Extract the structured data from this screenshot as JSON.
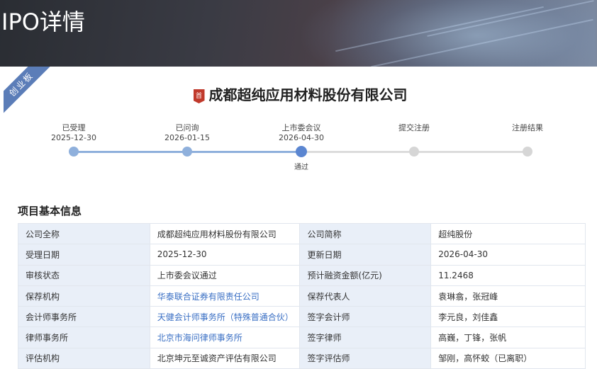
{
  "page": {
    "title": "IPO详情"
  },
  "board_ribbon": "创业板",
  "company": {
    "badge": "首",
    "name": "成都超纯应用材料股份有限公司"
  },
  "progress": {
    "steps": [
      {
        "label": "已受理",
        "date": "2025-12-30",
        "status": "done"
      },
      {
        "label": "已问询",
        "date": "2026-01-15",
        "status": "done"
      },
      {
        "label": "上市委会议",
        "date": "2026-04-30",
        "status": "current",
        "sub": "通过"
      },
      {
        "label": "提交注册",
        "date": "",
        "status": "todo"
      },
      {
        "label": "注册结果",
        "date": "",
        "status": "todo"
      }
    ]
  },
  "section": {
    "title": "项目基本信息"
  },
  "info": {
    "rows": [
      {
        "k1": "公司全称",
        "v1": "成都超纯应用材料股份有限公司",
        "k2": "公司简称",
        "v2": "超纯股份"
      },
      {
        "k1": "受理日期",
        "v1": "2025-12-30",
        "k2": "更新日期",
        "v2": "2026-04-30"
      },
      {
        "k1": "审核状态",
        "v1": "上市委会议通过",
        "k2": "预计融资金额(亿元)",
        "v2": "11.2468"
      },
      {
        "k1": "保荐机构",
        "v1": "华泰联合证券有限责任公司",
        "k2": "保荐代表人",
        "v2": "袁琳翕，张冠峰"
      },
      {
        "k1": "会计师事务所",
        "v1": "天健会计师事务所（特殊普通合伙）",
        "k2": "签字会计师",
        "v2": "李元良，刘佳鑫"
      },
      {
        "k1": "律师事务所",
        "v1": "北京市海问律师事务所",
        "k2": "签字律师",
        "v2": "高巍，丁锋，张帆"
      },
      {
        "k1": "评估机构",
        "v1": "北京坤元至诚资产评估有限公司",
        "k2": "签字评估师",
        "v2": "邹刚，高怀蛟（已离职）"
      }
    ]
  },
  "colors": {
    "accent": "#5b86d1",
    "link": "#3a6fc4",
    "header_cell": "#e9eff8",
    "ribbon": "#5b7db8"
  }
}
